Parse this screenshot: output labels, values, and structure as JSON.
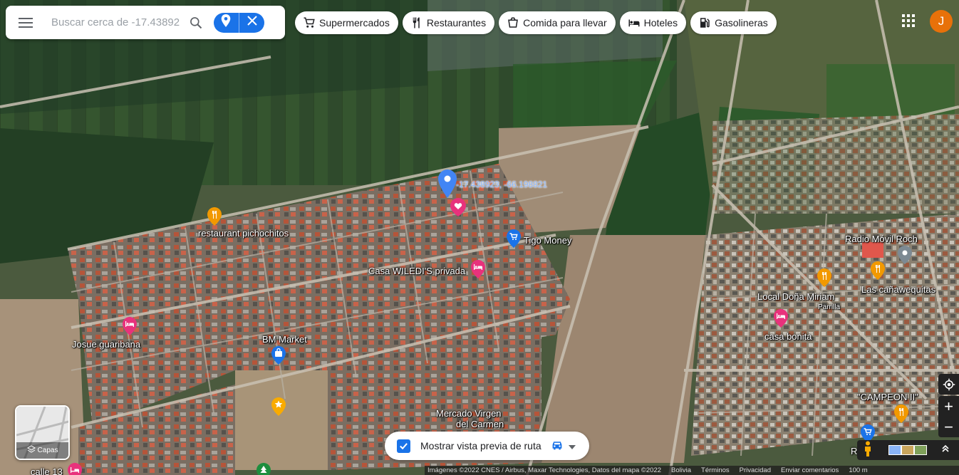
{
  "search": {
    "placeholder": "Buscar cerca de -17.43892",
    "value": ""
  },
  "chips": [
    {
      "label": "Supermercados",
      "icon": "cart-icon"
    },
    {
      "label": "Restaurantes",
      "icon": "fork-knife-icon"
    },
    {
      "label": "Comida para llevar",
      "icon": "takeout-icon"
    },
    {
      "label": "Hoteles",
      "icon": "bed-icon"
    },
    {
      "label": "Gasolineras",
      "icon": "gas-pump-icon"
    }
  ],
  "user": {
    "avatar_letter": "J",
    "avatar_color": "#e8710a"
  },
  "dropped_pin": {
    "coordinates": "-17.438923, -66.198821"
  },
  "places": {
    "restaurant_pichochitos": "restaurant pichochitos",
    "tigo_money": "Tigo Money",
    "casa_wiledis": "Casa WILEDI'S privada",
    "bm_market": "BM Market",
    "josue_guaribana": "Josue guaribana",
    "mercado_virgen": "Mercado Virgen",
    "del_carmen": "del Carmen",
    "calle_13": "calle 13",
    "radio_movil_roch": "Radio Móvil Roch",
    "las_canawequitas": "Las cañawequitas",
    "local_dona_miriam": "Local Doña Miriam",
    "parrilla": "Parrilla",
    "casa_bonita": "casa bonita",
    "campeon_ii": "\"CAMPEON II\"",
    "r_partial": "R"
  },
  "layers": {
    "label": "Capas"
  },
  "route_preview": {
    "label": "Mostrar vista previa de ruta",
    "checked": true
  },
  "controls": {
    "zoom_in": "+",
    "zoom_out": "−"
  },
  "footer": {
    "imagery": "Imágenes ©2022 CNES / Airbus, Maxar Technologies, Datos del mapa ©2022",
    "country": "Bolivia",
    "terms": "Términos",
    "privacy": "Privacidad",
    "feedback": "Enviar comentarios",
    "scale": "100 m"
  },
  "colors": {
    "accent_blue": "#1a73e8",
    "poi_orange": "#f29900",
    "poi_pink": "#e8327c",
    "poi_blue": "#1a73e8",
    "poi_gray": "#7d8a93",
    "poi_yellow": "#f9ab00",
    "poi_green": "#1e8e3e"
  }
}
